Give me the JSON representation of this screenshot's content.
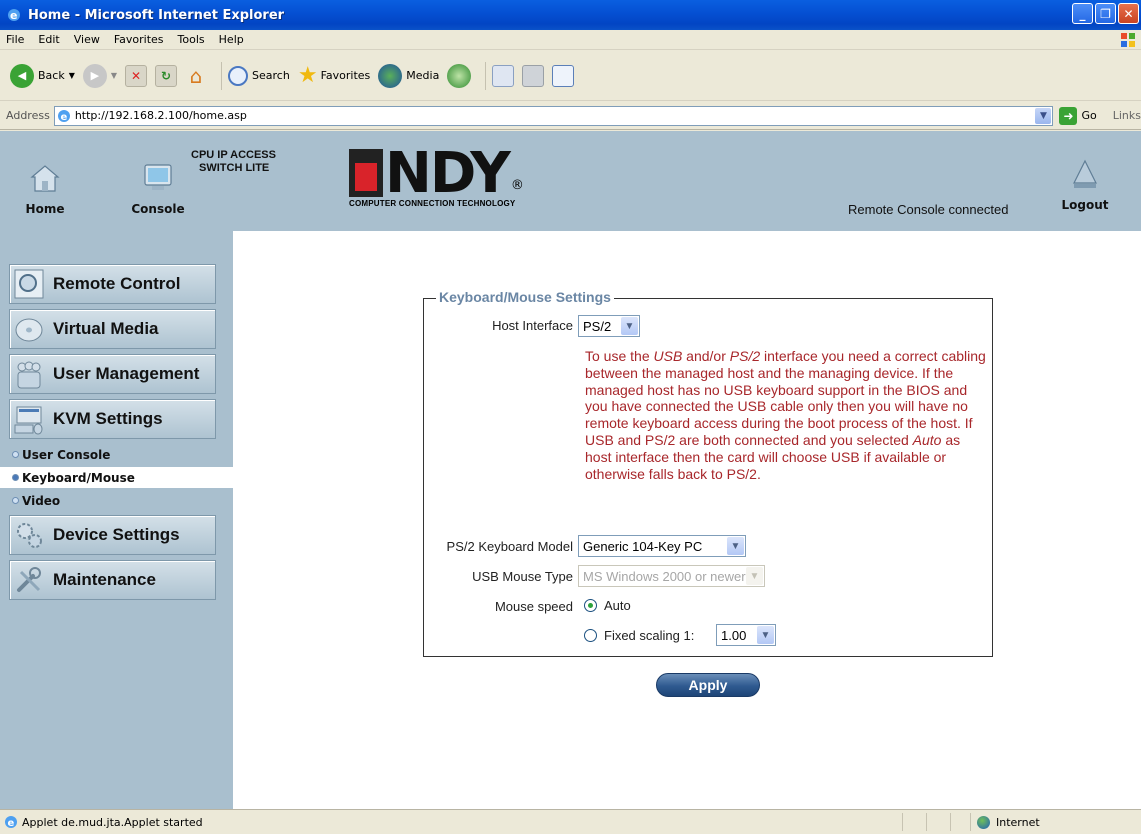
{
  "window": {
    "title": "Home - Microsoft Internet Explorer"
  },
  "menubar": [
    "File",
    "Edit",
    "View",
    "Favorites",
    "Tools",
    "Help"
  ],
  "toolbar": {
    "back": "Back",
    "search": "Search",
    "favorites": "Favorites",
    "media": "Media"
  },
  "address": {
    "label": "Address",
    "url": "http://192.168.2.100/home.asp",
    "go": "Go",
    "links": "Links"
  },
  "header": {
    "home": "Home",
    "console": "Console",
    "logout": "Logout",
    "status": "Remote Console connected",
    "logo_text": "NDY",
    "logo_registered": "®",
    "logo_tagline": "COMPUTER CONNECTION TECHNOLOGY",
    "product_line1": "CPU IP ACCESS",
    "product_line2": "SWITCH LITE"
  },
  "sidebar": {
    "items": [
      {
        "label": "Remote Control"
      },
      {
        "label": "Virtual Media"
      },
      {
        "label": "User Management"
      },
      {
        "label": "KVM Settings"
      },
      {
        "label": "Device Settings"
      },
      {
        "label": "Maintenance"
      }
    ],
    "sub_items": [
      {
        "label": "User Console",
        "active": false
      },
      {
        "label": "Keyboard/Mouse",
        "active": true
      },
      {
        "label": "Video",
        "active": false
      }
    ]
  },
  "settings": {
    "legend": "Keyboard/Mouse Settings",
    "host_interface_label": "Host Interface",
    "host_interface_value": "PS/2",
    "note_p1": "To use the ",
    "note_usb": "USB",
    "note_p2": " and/or ",
    "note_ps2": "PS/2",
    "note_p3": " interface you need a correct cabling between the managed host and the managing device. If the managed host has no USB keyboard support in the BIOS and you have connected the USB cable only then you will have no remote keyboard access during the boot process of the host. If USB and PS/2 are both connected and you selected ",
    "note_auto": "Auto",
    "note_p4": " as host interface then the card will choose USB if available or otherwise falls back to PS/2.",
    "keyboard_model_label": "PS/2 Keyboard Model",
    "keyboard_model_value": "Generic 104-Key PC",
    "usb_mouse_label": "USB Mouse Type",
    "usb_mouse_value": "MS Windows 2000 or newer",
    "mouse_speed_label": "Mouse speed",
    "mouse_speed_auto": "Auto",
    "mouse_speed_fixed": "Fixed scaling 1:",
    "scaling_value": "1.00",
    "apply": "Apply"
  },
  "statusbar": {
    "text": "Applet de.mud.jta.Applet started",
    "zone": "Internet"
  },
  "colors": {
    "header_bg": "#a9bfce",
    "note_red": "#a8272b",
    "legend_blue": "#6a86a4"
  }
}
